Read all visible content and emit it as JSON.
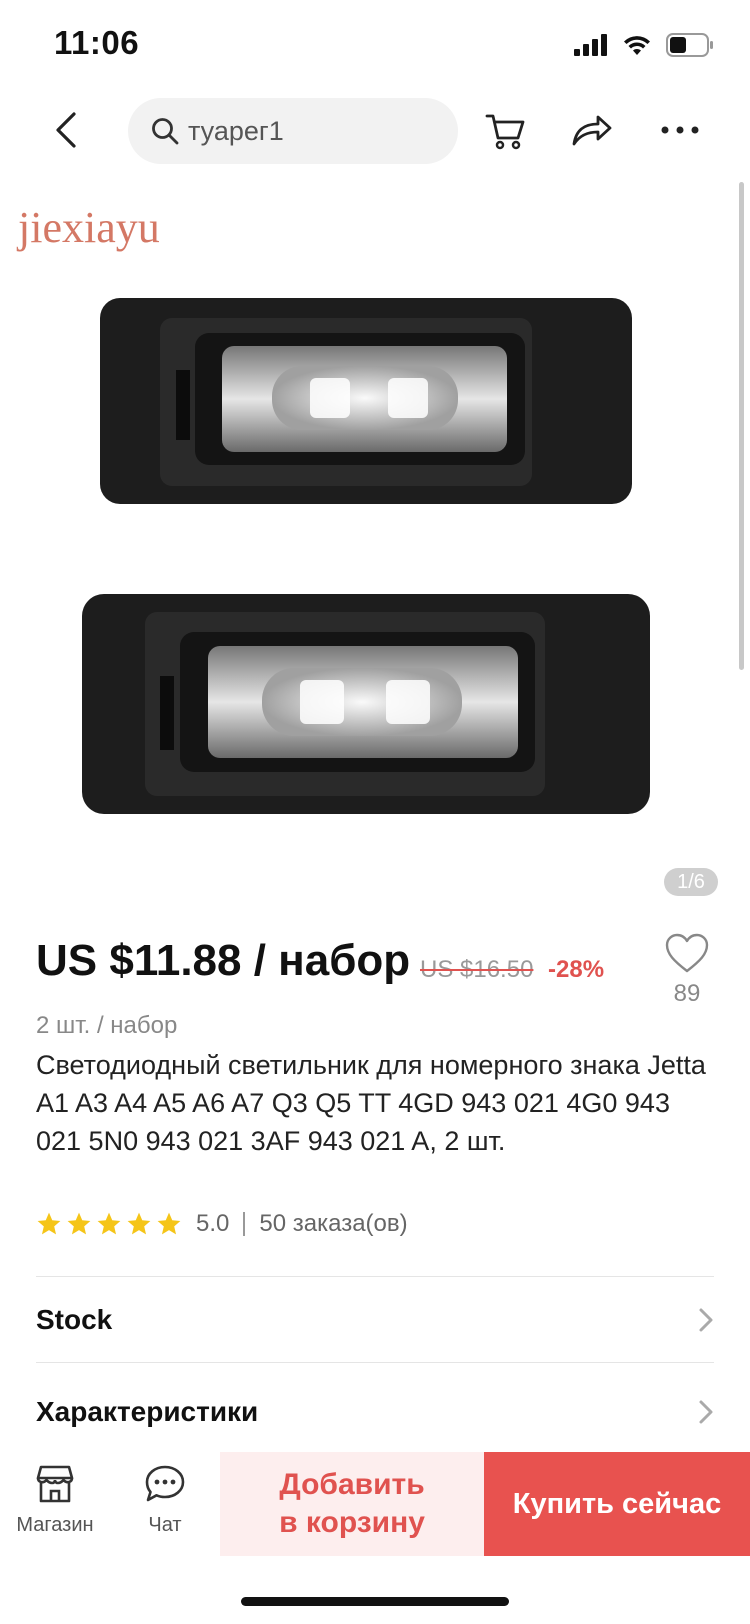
{
  "status_bar": {
    "time": "11:06"
  },
  "search": {
    "query": "туарег1"
  },
  "gallery": {
    "watermark": "jiexiayu",
    "counter": "1/6"
  },
  "product": {
    "price": "US $11.88 / набор",
    "old_price": "US $16.50",
    "discount": "-28%",
    "wishlist_count": "89",
    "unit": "2 шт. / набор",
    "title": "Светодиодный светильник для номерного знака Jetta A1 A3 A4 A5 A6 A7 Q3 Q5 TT 4GD 943 021 4G0 943 021 5N0 943 021 3AF 943 021 A, 2 шт.",
    "rating": "5.0",
    "rating_stars": 5,
    "orders": "50 заказа(ов)"
  },
  "rows": [
    {
      "label": "Stock"
    },
    {
      "label": "Характеристики"
    }
  ],
  "bottom_bar": {
    "store_label": "Магазин",
    "chat_label": "Чат",
    "add_to_cart_line1": "Добавить",
    "add_to_cart_line2": "в корзину",
    "buy_now": "Купить сейчас"
  },
  "colors": {
    "accent": "#e8524f",
    "accent_light": "#fdeeee",
    "star": "#f5c518",
    "watermark": "#d47865"
  },
  "icons": [
    "back-icon",
    "search-icon",
    "cart-icon",
    "share-icon",
    "more-icon",
    "heart-icon",
    "star-icon",
    "chevron-right-icon",
    "store-icon",
    "chat-icon"
  ]
}
